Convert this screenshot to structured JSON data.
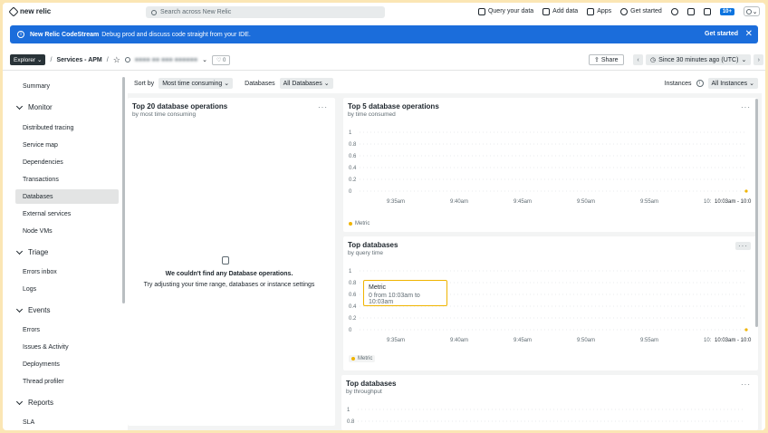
{
  "app": {
    "brand": "new relic"
  },
  "search": {
    "placeholder": "Search across New Relic"
  },
  "top_actions": {
    "query": "Query your data",
    "add_data": "Add data",
    "apps": "Apps",
    "get_started": "Get started",
    "badge": "10+"
  },
  "banner": {
    "title": "New Relic CodeStream",
    "text": "Debug prod and discuss code straight from your IDE.",
    "cta": "Get started"
  },
  "breadcrumb": {
    "explorer": "Explorer",
    "sep": "/",
    "section": "Services - APM",
    "app_name": "■■■■ ■■ ■■■ ■■■■■■",
    "favorites": "0",
    "share": "Share",
    "time_range": "Since 30 minutes ago (UTC)"
  },
  "sidebar": {
    "summary": "Summary",
    "monitor": "Monitor",
    "distributed_tracing": "Distributed tracing",
    "service_map": "Service map",
    "dependencies": "Dependencies",
    "transactions": "Transactions",
    "databases": "Databases",
    "external_services": "External services",
    "node_vms": "Node VMs",
    "triage": "Triage",
    "errors_inbox": "Errors inbox",
    "logs": "Logs",
    "events": "Events",
    "errors": "Errors",
    "issues": "Issues & Activity",
    "deployments": "Deployments",
    "thread_profiler": "Thread profiler",
    "reports": "Reports",
    "sla": "SLA"
  },
  "filters": {
    "sort_label": "Sort by",
    "sort_value": "Most time consuming",
    "db_label": "Databases",
    "db_value": "All Databases",
    "instances_label": "Instances",
    "instances_value": "All Instances"
  },
  "left_card": {
    "title": "Top 20 database operations",
    "subtitle": "by most time consuming",
    "empty_title": "We couldn't find any Database operations.",
    "empty_sub": "Try adjusting your time range, databases or instance settings",
    "menu": "···"
  },
  "chart_cards": [
    {
      "title": "Top 5 database operations",
      "subtitle": "by time consumed",
      "legend": "Metric"
    },
    {
      "title": "Top databases",
      "subtitle": "by query time",
      "legend": "Metric"
    },
    {
      "title": "Top databases",
      "subtitle": "by throughput",
      "legend": ""
    }
  ],
  "tooltip": {
    "title": "Metric",
    "text": "0 from 10:03am to 10:03am"
  },
  "chart_data": [
    {
      "type": "line",
      "title": "Top 5 database operations",
      "subtitle": "by time consumed",
      "y_ticks": [
        "1",
        "0.8",
        "0.6",
        "0.4",
        "0.2",
        "0"
      ],
      "x_ticks": [
        "9:35am",
        "9:40am",
        "9:45am",
        "9:50am",
        "9:55am",
        "10:",
        "10:03am - 10:0"
      ],
      "ylim": [
        0,
        1
      ],
      "series": [
        {
          "name": "Metric",
          "values": [
            0
          ]
        }
      ],
      "color": "#f0b400"
    },
    {
      "type": "line",
      "title": "Top databases",
      "subtitle": "by query time",
      "y_ticks": [
        "1",
        "0.8",
        "0.6",
        "0.4",
        "0.2",
        "0"
      ],
      "x_ticks": [
        "9:35am",
        "9:40am",
        "9:45am",
        "9:50am",
        "9:55am",
        "10:",
        "10:03am - 10:0"
      ],
      "ylim": [
        0,
        1
      ],
      "series": [
        {
          "name": "Metric",
          "values": [
            0
          ]
        }
      ],
      "color": "#f0b400"
    },
    {
      "type": "line",
      "title": "Top databases",
      "subtitle": "by throughput",
      "y_ticks": [
        "1",
        "0.8"
      ],
      "ylim": [
        0,
        1
      ],
      "series": []
    }
  ]
}
